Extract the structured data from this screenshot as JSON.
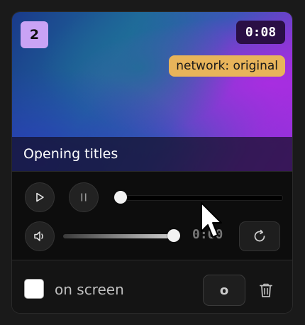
{
  "clip": {
    "number": "2",
    "duration": "0:08",
    "network_label": "network: original",
    "title": "Opening titles"
  },
  "player": {
    "progress_fraction": 0.0,
    "volume_fraction": 1.0,
    "time_readout": "0:00"
  },
  "footer": {
    "checkbox_checked": false,
    "checkbox_label": "on screen",
    "key_label": "o"
  },
  "icons": {
    "play": "play-icon",
    "pause": "pause-icon",
    "volume": "volume-icon",
    "reset": "reset-icon",
    "trash": "trash-icon",
    "cursor": "mouse-cursor-icon"
  },
  "colors": {
    "number_badge": "#c9a3f5",
    "time_badge": "#2a0f45",
    "network_badge": "#e8b45a",
    "card_background": "#121212"
  }
}
